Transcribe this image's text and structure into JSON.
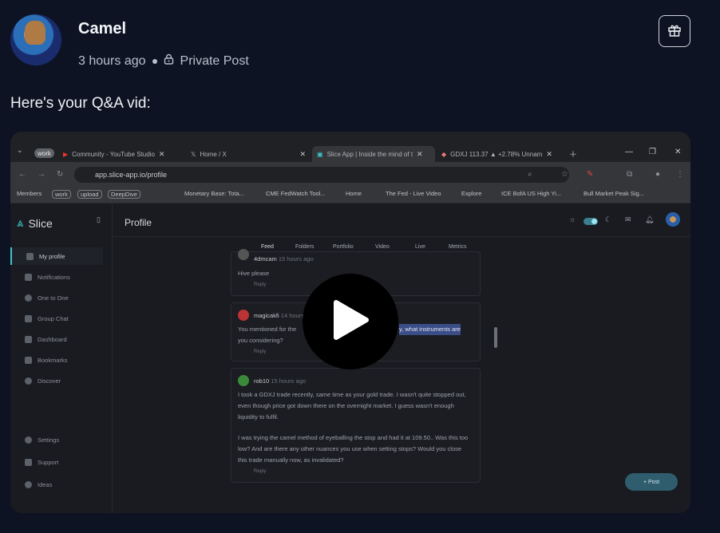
{
  "post": {
    "author": "Camel",
    "time": "3 hours ago",
    "visibility": "Private Post",
    "text": "Here's your Q&A vid:",
    "icons": {
      "gift": "gift-icon",
      "lock": "lock-icon",
      "play": "play-icon"
    }
  },
  "video": {
    "browser": {
      "tab_group": "work",
      "tabs": [
        "Community - YouTube Studio",
        "Home / X",
        "Slice App | Inside the mind of t",
        "GDXJ 113.37 ▲ +2.78% Unnam"
      ],
      "url": "app.slice-app.io/profile",
      "bookmarks": [
        "Members",
        "work",
        "upload",
        "DeepDive",
        "Monetary Base: Tota...",
        "CME FedWatch Tool...",
        "Home",
        "The Fed - Live Video",
        "Explore",
        "ICE BofA US High Yi...",
        "Bull Market Peak Sig..."
      ]
    },
    "app": {
      "logo": "Slice",
      "page_title": "Profile",
      "sidebar": [
        "My profile",
        "Notifications",
        "One to One",
        "Group Chat",
        "Dashboard",
        "Bookmarks",
        "Discover"
      ],
      "sidebar_bottom": [
        "Settings",
        "Support",
        "Ideas"
      ],
      "tabs": [
        "Feed",
        "Folders",
        "Portfolio",
        "Video",
        "Live",
        "Metrics"
      ],
      "comments": [
        {
          "user": "4dmcam",
          "time": "15 hours ago",
          "text": "Hive please",
          "reply": "Reply"
        },
        {
          "user": "magicakfi",
          "time": "14 hours ago",
          "text_a": "You mentioned for the",
          "text_b": "y, what instruments are",
          "text_c": "you considering?",
          "reply": "Reply"
        },
        {
          "user": "rob10",
          "time": "15 hours ago",
          "lines": [
            "I took a GDXJ trade recently, same time as your gold trade. I wasn't quite stopped out,",
            "even though price got down there on the overnight market. I guess wasn't enough",
            "liquidity to fulfil.",
            "",
            "I was trying the camel method of eyeballing the stop and had it at 109.50.. Was this too",
            "low? And are there any other nuances you use when setting stops? Would you close",
            "this trade manually now, as invalidated?"
          ],
          "reply": "Reply"
        }
      ],
      "post_button": "+ Post"
    }
  }
}
